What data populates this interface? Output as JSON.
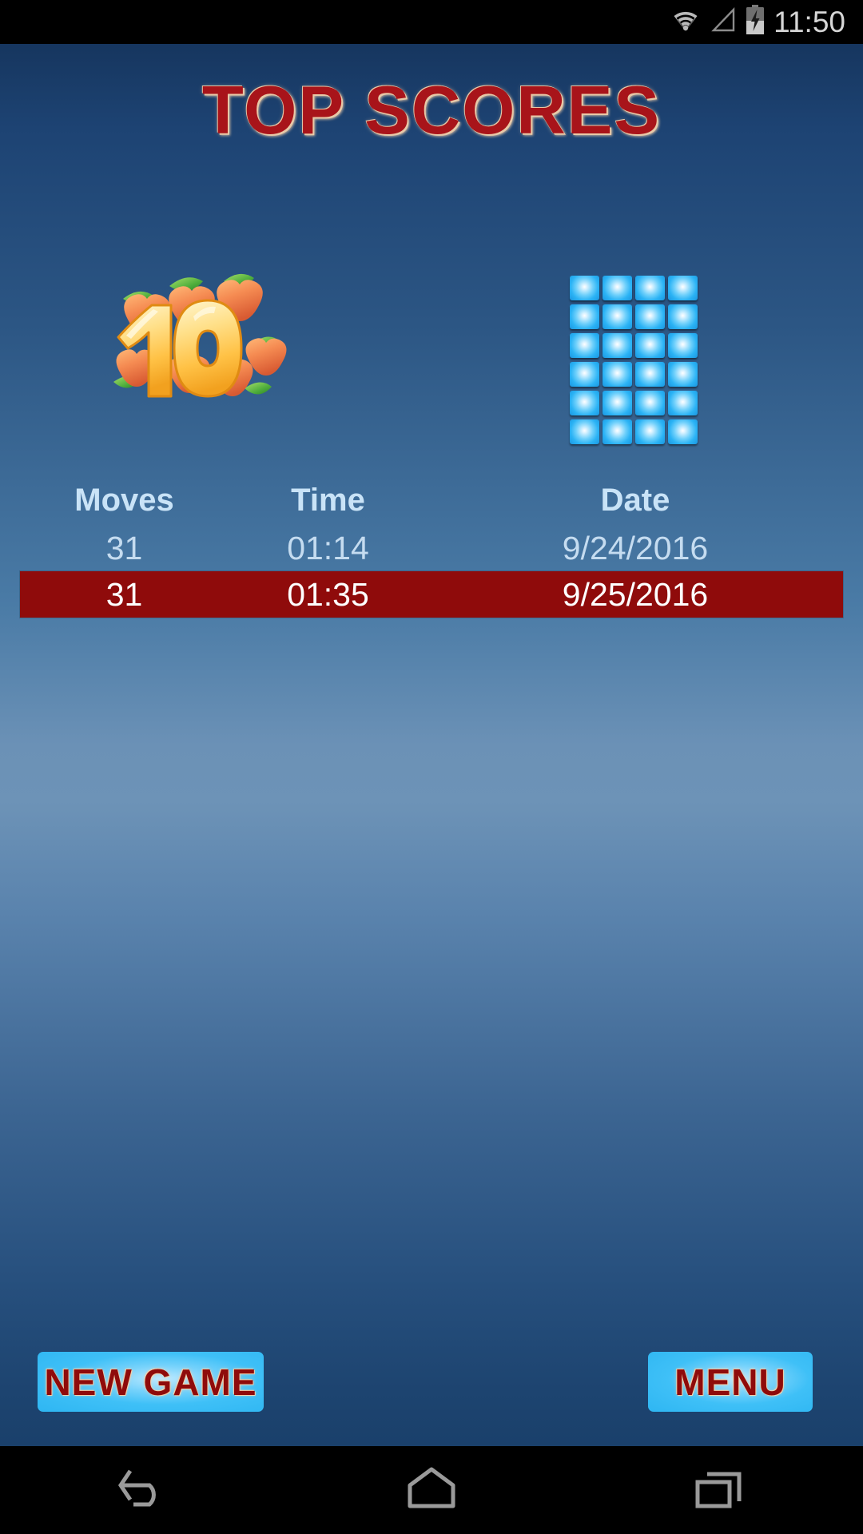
{
  "status_bar": {
    "clock": "11:50",
    "icons": [
      "wifi-icon",
      "signal-icon",
      "battery-charging-icon"
    ]
  },
  "screen": {
    "title": "TOP SCORES",
    "level_logo": {
      "name": "level-10-apples-logo",
      "number": "10"
    },
    "tile_grid": {
      "columns": 4,
      "rows": 6,
      "tile_count": 24
    }
  },
  "scores": {
    "columns": [
      "Moves",
      "Time",
      "Date"
    ],
    "rows": [
      {
        "moves": "31",
        "time": "01:14",
        "date": "9/24/2016",
        "highlighted": false
      },
      {
        "moves": "31",
        "time": "01:35",
        "date": "9/25/2016",
        "highlighted": true
      }
    ]
  },
  "buttons": {
    "new_game": "NEW GAME",
    "menu": "MENU"
  },
  "nav_bar": {
    "back": "back-icon",
    "home": "home-icon",
    "recents": "recents-icon"
  },
  "colors": {
    "title_red": "#a8141a",
    "highlight_row": "#8f0b0b",
    "button_blue": "#3fc0f7",
    "header_text": "#c9e3f7",
    "bg_top": "#1d4373",
    "bg_mid": "#6b91b6"
  }
}
